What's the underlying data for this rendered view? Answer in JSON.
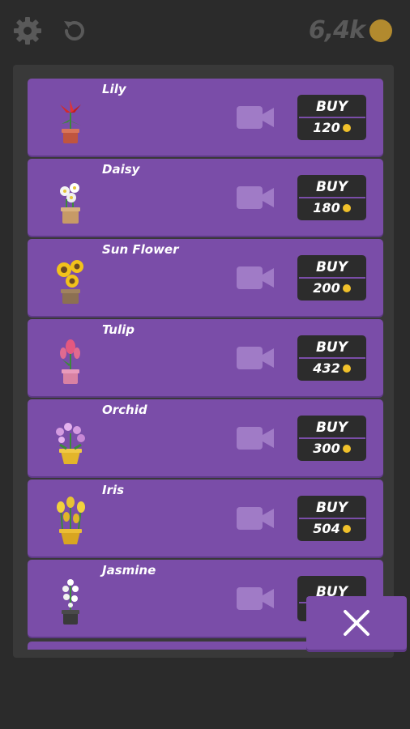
{
  "header": {
    "settings_icon": "gear-icon",
    "restart_icon": "refresh-icon",
    "coins": "6,4k",
    "coin_color": "#b28a2e"
  },
  "shop": {
    "buy_label": "BUY",
    "video_icon": "video-camera-icon",
    "items": [
      {
        "name": "Lily",
        "price": "120",
        "plant": "red-lily"
      },
      {
        "name": "Daisy",
        "price": "180",
        "plant": "white-daisy"
      },
      {
        "name": "Sun Flower",
        "price": "200",
        "plant": "sunflower"
      },
      {
        "name": "Tulip",
        "price": "432",
        "plant": "pink-tulip"
      },
      {
        "name": "Orchid",
        "price": "300",
        "plant": "purple-orchid"
      },
      {
        "name": "Iris",
        "price": "504",
        "plant": "yellow-iris"
      },
      {
        "name": "Jasmine",
        "price": "",
        "plant": "white-jasmine"
      }
    ]
  },
  "close_icon": "close-icon",
  "colors": {
    "row": "#7a4da8",
    "panel": "#393939",
    "background": "#2b2b2b",
    "coin": "#f0c12b"
  }
}
